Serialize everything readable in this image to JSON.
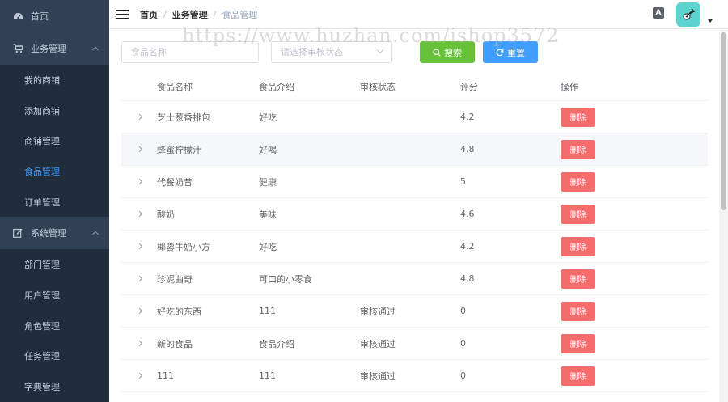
{
  "sidebar": {
    "top_items": [
      {
        "label": "首页",
        "icon": "dashboard-icon"
      }
    ],
    "groups": [
      {
        "label": "业务管理",
        "icon": "cart-icon",
        "items": [
          {
            "label": "我的商铺",
            "active": false
          },
          {
            "label": "添加商铺",
            "active": false
          },
          {
            "label": "商铺管理",
            "active": false
          },
          {
            "label": "食品管理",
            "active": true
          },
          {
            "label": "订单管理",
            "active": false
          }
        ]
      },
      {
        "label": "系统管理",
        "icon": "edit-icon",
        "items": [
          {
            "label": "部门管理",
            "active": false
          },
          {
            "label": "用户管理",
            "active": false
          },
          {
            "label": "角色管理",
            "active": false
          },
          {
            "label": "任务管理",
            "active": false
          },
          {
            "label": "字典管理",
            "active": false
          }
        ]
      }
    ]
  },
  "header": {
    "breadcrumb": [
      "首页",
      "业务管理",
      "食品管理"
    ],
    "breadcrumb_sep": "/",
    "lang_label": "A"
  },
  "watermark": "https://www.huzhan.com/ishop3572",
  "filters": {
    "name_placeholder": "食品名称",
    "name_value": "",
    "status_placeholder": "请选择审核状态",
    "search_label": "搜索",
    "reset_label": "重置"
  },
  "table": {
    "columns": [
      "食品名称",
      "食品介绍",
      "审核状态",
      "评分",
      "操作"
    ],
    "delete_label": "删除",
    "rows": [
      {
        "name": "芝士葱香排包",
        "desc": "好吃",
        "status": "",
        "score": "4.2"
      },
      {
        "name": "蜂蜜柠檬汁",
        "desc": "好喝",
        "status": "",
        "score": "4.8"
      },
      {
        "name": "代餐奶昔",
        "desc": "健康",
        "status": "",
        "score": "5"
      },
      {
        "name": "酸奶",
        "desc": "美味",
        "status": "",
        "score": "4.6"
      },
      {
        "name": "椰蓉牛奶小方",
        "desc": "好吃",
        "status": "",
        "score": "4.2"
      },
      {
        "name": "珍妮曲奇",
        "desc": "可口的小零食",
        "status": "",
        "score": "4.8"
      },
      {
        "name": "好吃的东西",
        "desc": "111",
        "status": "审核通过",
        "score": "0"
      },
      {
        "name": "新的食品",
        "desc": "食品介绍",
        "status": "审核通过",
        "score": "0"
      },
      {
        "name": "111",
        "desc": "111",
        "status": "审核通过",
        "score": "0"
      }
    ]
  },
  "colors": {
    "sidebar_bg": "#304156",
    "submenu_bg": "#1f2d3d",
    "active": "#409eff",
    "search_btn": "#67c23a",
    "reset_btn": "#409eff",
    "delete_btn": "#f56c6c"
  }
}
